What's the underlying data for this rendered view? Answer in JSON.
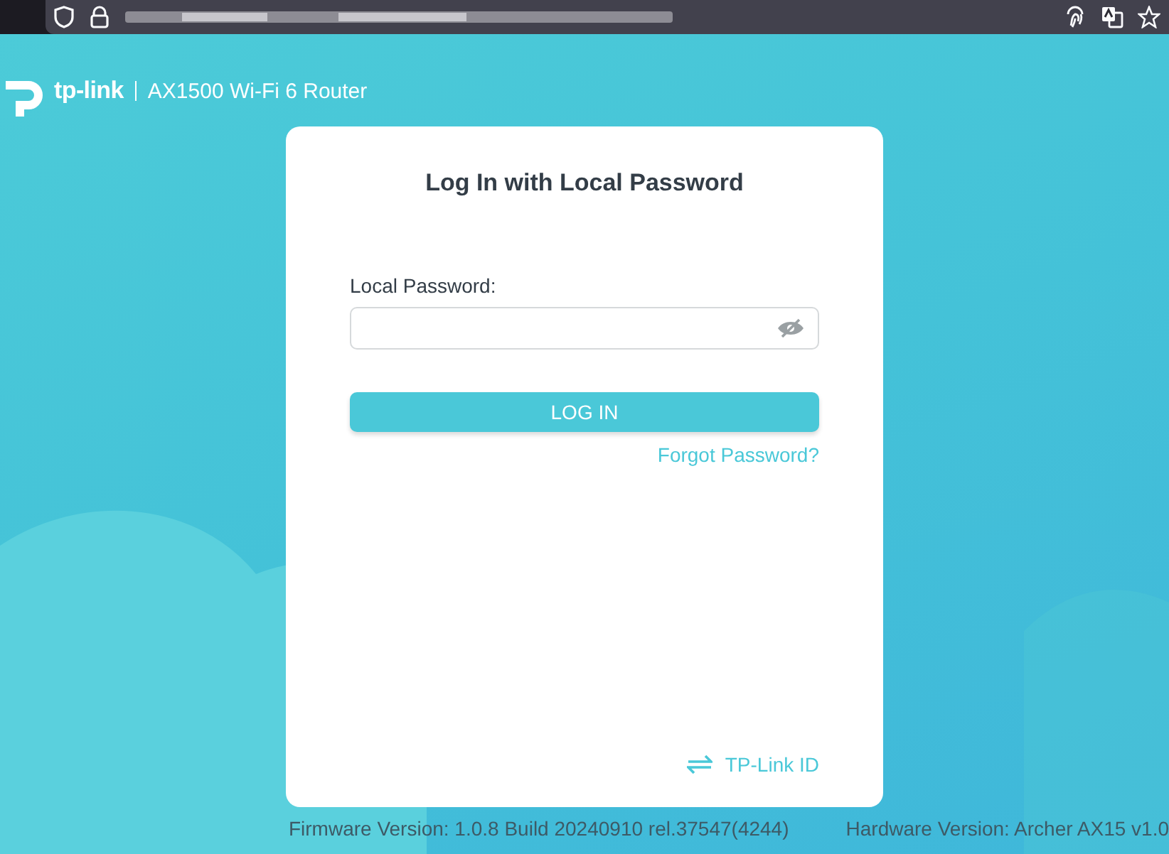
{
  "header": {
    "brand": "tp-link",
    "model": "AX1500 Wi-Fi 6 Router"
  },
  "login": {
    "title": "Log In with Local Password",
    "password_label": "Local Password:",
    "password_visible": false,
    "button": "LOG IN",
    "forgot": "Forgot Password?",
    "switch_link": "TP-Link ID"
  },
  "footer": {
    "firmware": "Firmware Version: 1.0.8 Build 20240910 rel.37547(4244)",
    "hardware": "Hardware Version: Archer AX15 v1.0"
  }
}
